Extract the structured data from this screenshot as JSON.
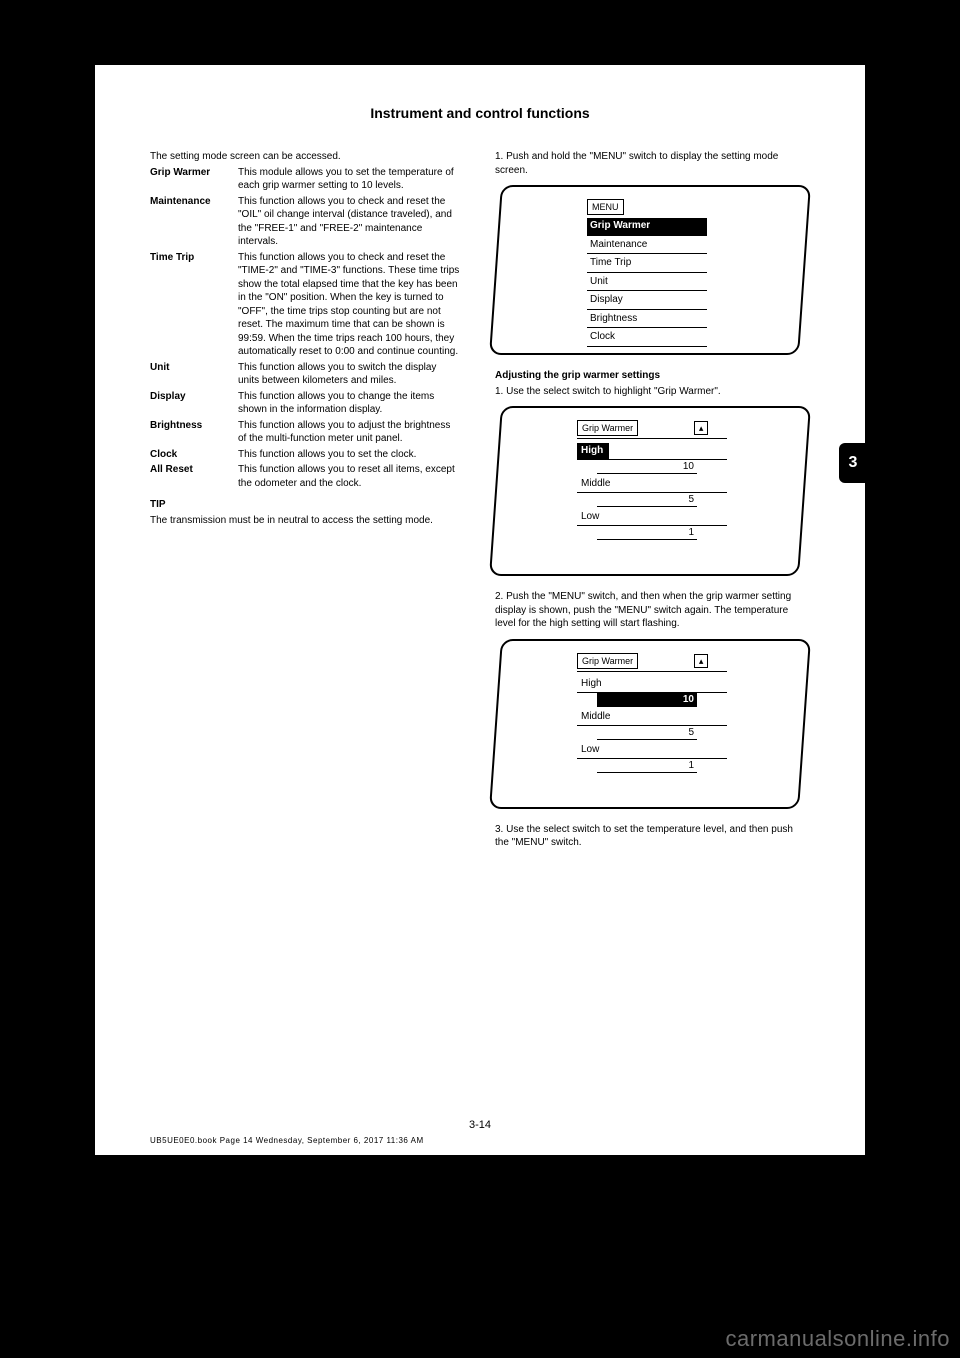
{
  "header": "Instrument and control functions",
  "tab_number": "3",
  "page_number": "3-14",
  "footer_code": "UB5UE0E0.book  Page 14  Wednesday, September 6, 2017  11:36 AM",
  "watermark": "carmanualsonline.info",
  "left": {
    "intro_line": "The setting mode screen can be accessed.",
    "defs": [
      {
        "term": "Grip Warmer",
        "desc": "This module allows you to set the temperature of each grip warmer setting to 10 levels."
      },
      {
        "term": "Maintenance",
        "desc": "This function allows you to check and reset the \"OIL\" oil change interval (distance traveled), and the \"FREE-1\" and \"FREE-2\" maintenance intervals."
      },
      {
        "term": "Time Trip",
        "desc": "This function allows you to check and reset the \"TIME-2\" and \"TIME-3\" functions. These time trips show the total elapsed time that the key has been in the \"ON\" position. When the key is turned to \"OFF\", the time trips stop counting but are not reset. The maximum time that can be shown is 99:59. When the time trips reach 100 hours, they automatically reset to 0:00 and continue counting."
      },
      {
        "term": "Unit",
        "desc": "This function allows you to switch the display units between kilometers and miles."
      },
      {
        "term": "Display",
        "desc": "This function allows you to change the items shown in the information display."
      },
      {
        "term": "Brightness",
        "desc": "This function allows you to adjust the brightness of the multi-function meter unit panel."
      },
      {
        "term": "Clock",
        "desc": "This function allows you to set the clock."
      },
      {
        "term": "All Reset",
        "desc": "This function allows you to reset all items, except the odometer and the clock."
      }
    ],
    "tip_heading": "TIP",
    "tip_body": "The transmission must be in neutral to access the setting mode."
  },
  "right": {
    "step1": "1. Push and hold the \"MENU\" switch to display the setting mode screen.",
    "menu_screen": {
      "label": "MENU",
      "items": [
        "Grip Warmer",
        "Maintenance",
        "Time Trip",
        "Unit",
        "Display",
        "Brightness",
        "Clock"
      ],
      "selected_index": 0
    },
    "adj_heading": "Adjusting the grip warmer settings",
    "adj_step1": "1. Use the select switch to highlight \"Grip Warmer\".",
    "gw_screen1": {
      "title": "Grip Warmer",
      "rows": [
        {
          "label": "High",
          "value": "10",
          "label_selected": true,
          "value_selected": false
        },
        {
          "label": "Middle",
          "value": "5",
          "label_selected": false,
          "value_selected": false
        },
        {
          "label": "Low",
          "value": "1",
          "label_selected": false,
          "value_selected": false
        }
      ]
    },
    "adj_step2": "2. Push the \"MENU\" switch, and then when the grip warmer setting display is shown, push the \"MENU\" switch again. The temperature level for the high setting will start flashing.",
    "gw_screen2": {
      "title": "Grip Warmer",
      "rows": [
        {
          "label": "High",
          "value": "10",
          "label_selected": false,
          "value_selected": true
        },
        {
          "label": "Middle",
          "value": "5",
          "label_selected": false,
          "value_selected": false
        },
        {
          "label": "Low",
          "value": "1",
          "label_selected": false,
          "value_selected": false
        }
      ]
    },
    "adj_step3": "3. Use the select switch to set the temperature level, and then push the \"MENU\" switch."
  }
}
